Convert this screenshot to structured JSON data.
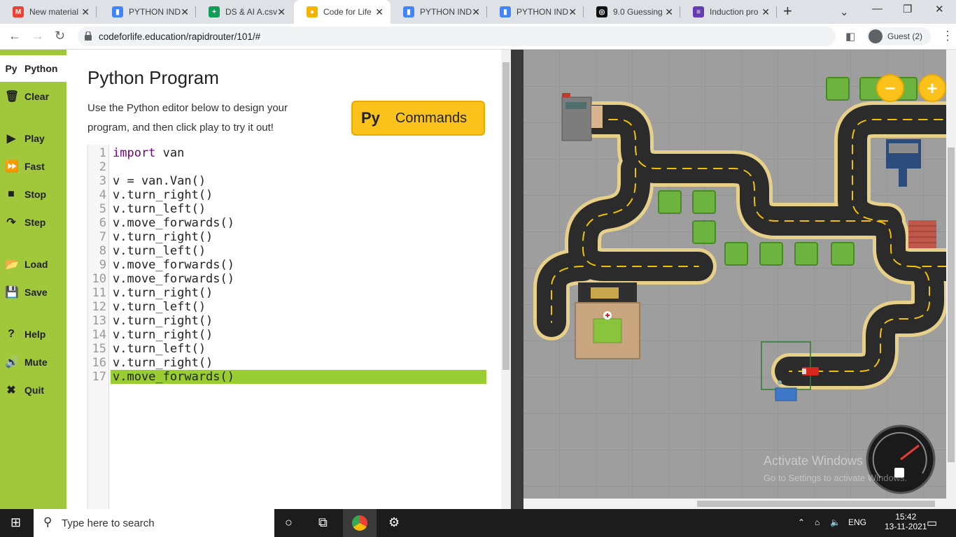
{
  "browser": {
    "tabs": [
      {
        "title": "New material",
        "fav": "M",
        "color": "#ea4335"
      },
      {
        "title": "PYTHON IND",
        "fav": "▮",
        "color": "#4285f4"
      },
      {
        "title": "DS & AI A.csv",
        "fav": "+",
        "color": "#0f9d58"
      },
      {
        "title": "Code for Life",
        "fav": "●",
        "color": "#f4b400"
      },
      {
        "title": "PYTHON IND",
        "fav": "▮",
        "color": "#4285f4"
      },
      {
        "title": "PYTHON IND",
        "fav": "▮",
        "color": "#4285f4"
      },
      {
        "title": "9.0 Guessing",
        "fav": "◎",
        "color": "#111111"
      },
      {
        "title": "Induction pro",
        "fav": "≡",
        "color": "#673ab7"
      }
    ],
    "url": "codeforlife.education/rapidrouter/101/#",
    "profile": "Guest (2)"
  },
  "sidebar": {
    "tab": {
      "py": "Py",
      "label": "Python"
    },
    "items": [
      {
        "label": "Clear",
        "icon": "trash-icon"
      },
      {
        "label": "Play",
        "icon": "play-icon"
      },
      {
        "label": "Fast",
        "icon": "fast-forward-icon"
      },
      {
        "label": "Stop",
        "icon": "stop-icon"
      },
      {
        "label": "Step",
        "icon": "step-icon"
      },
      {
        "label": "Load",
        "icon": "folder-icon"
      },
      {
        "label": "Save",
        "icon": "save-icon"
      },
      {
        "label": "Help",
        "icon": "help-icon"
      },
      {
        "label": "Mute",
        "icon": "speaker-icon"
      },
      {
        "label": "Quit",
        "icon": "close-icon"
      }
    ]
  },
  "editor": {
    "title": "Python Program",
    "description": "Use the Python editor below to design your program, and then click play to try it out!",
    "commands": {
      "py": "Py",
      "label": "Commands"
    },
    "lines": [
      "import van",
      "",
      "v = van.Van()",
      "v.turn_right()",
      "v.turn_left()",
      "v.move_forwards()",
      "v.turn_right()",
      "v.turn_left()",
      "v.move_forwards()",
      "v.move_forwards()",
      "v.turn_right()",
      "v.turn_left()",
      "v.turn_right()",
      "v.turn_right()",
      "v.turn_left()",
      "v.turn_right()",
      "v.move_forwards()"
    ],
    "highlighted_line": 17
  },
  "game": {
    "zoom_out": "−",
    "zoom_in": "+",
    "watermark_title": "Activate Windows",
    "watermark_sub": "Go to Settings to activate Windows."
  },
  "taskbar": {
    "search_placeholder": "Type here to search",
    "lang": "ENG",
    "time": "15:42",
    "date": "13-11-2021"
  }
}
